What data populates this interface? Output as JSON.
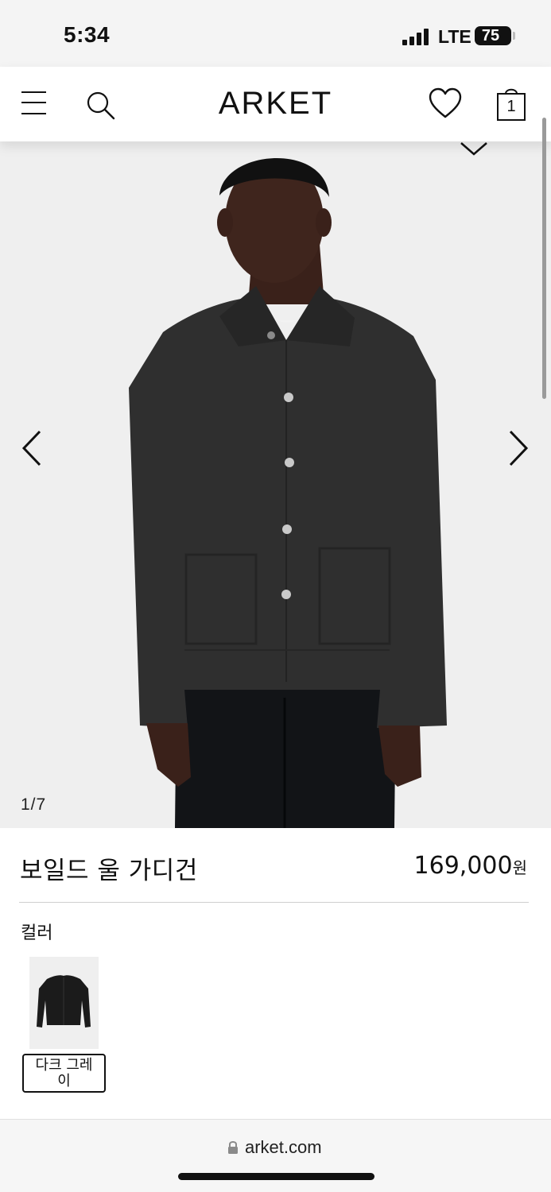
{
  "status_bar": {
    "time": "5:34",
    "network": "LTE",
    "battery": "75"
  },
  "header": {
    "brand": "ARKET",
    "bag_count": "1"
  },
  "gallery": {
    "counter": "1/7"
  },
  "product": {
    "name": "보일드 울 가디건",
    "price": "169,000",
    "currency": "원",
    "color_label": "컬러",
    "selected_color": "다크 그레\n이"
  },
  "browser": {
    "url": "arket.com"
  },
  "colors": {
    "garment": "#2f2f2f",
    "background": "#efefef",
    "accent": "#111111"
  }
}
